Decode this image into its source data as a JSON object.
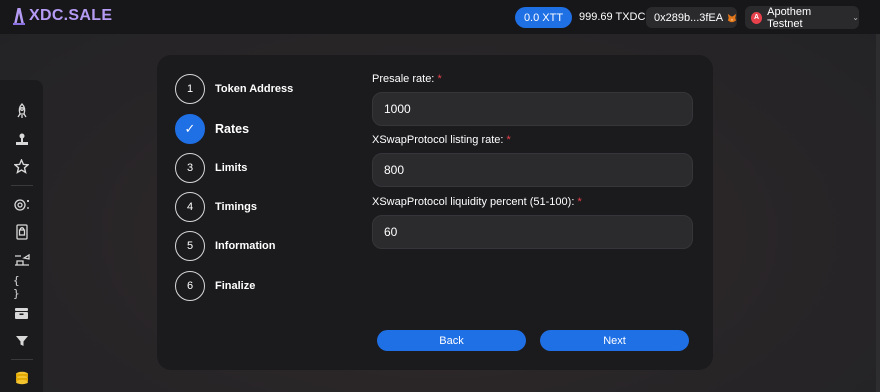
{
  "header": {
    "logo_text": "XDC.SALE",
    "xtt_label": "0.0 XTT",
    "balance": "999.69 TXDC",
    "wallet_address": "0x289b...3fEA",
    "network": "Apothem Testnet",
    "network_badge": "A"
  },
  "sidebar": {
    "items": [
      {
        "name": "rocket-icon"
      },
      {
        "name": "stamp-icon"
      },
      {
        "name": "star-icon"
      },
      {
        "name": "coin-settings-icon"
      },
      {
        "name": "lock-icon"
      },
      {
        "name": "airdrop-icon"
      },
      {
        "name": "code-braces-icon"
      },
      {
        "name": "wallet-box-icon"
      },
      {
        "name": "filter-icon"
      },
      {
        "name": "coins-icon"
      }
    ]
  },
  "steps": [
    {
      "number": "1",
      "label": "Token Address",
      "active": false
    },
    {
      "number": "✓",
      "label": "Rates",
      "active": true
    },
    {
      "number": "3",
      "label": "Limits",
      "active": false
    },
    {
      "number": "4",
      "label": "Timings",
      "active": false
    },
    {
      "number": "5",
      "label": "Information",
      "active": false
    },
    {
      "number": "6",
      "label": "Finalize",
      "active": false
    }
  ],
  "form": {
    "presale_rate": {
      "label": "Presale rate:",
      "required": "*",
      "value": "1000"
    },
    "listing_rate": {
      "label": "XSwapProtocol listing rate:",
      "required": "*",
      "value": "800"
    },
    "liquidity_percent": {
      "label": "XSwapProtocol liquidity percent (51-100):",
      "required": "*",
      "value": "60"
    }
  },
  "buttons": {
    "back": "Back",
    "next": "Next"
  },
  "colors": {
    "accent": "#1f6fe5",
    "required": "#e8414b",
    "logo": "#b59bf4"
  }
}
